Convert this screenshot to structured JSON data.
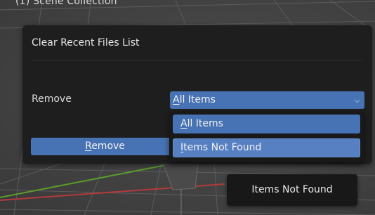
{
  "viewport": {
    "scene_collection_label": "(1) Scene Collection"
  },
  "dialog": {
    "title": "Clear Recent Files List",
    "remove_label": "Remove",
    "select_value": "All Items",
    "select_value_accel": "A",
    "select_value_rest": "ll Items",
    "remove_button_accel": "R",
    "remove_button_rest": "emove",
    "remove_button_label": "Remove"
  },
  "menu": {
    "options": [
      {
        "label": "All Items",
        "accel": "A",
        "rest": "ll Items",
        "state": "selected"
      },
      {
        "label": "Items Not Found",
        "accel": "I",
        "rest": "tems Not Found",
        "state": "hovered"
      }
    ]
  },
  "tooltip": {
    "text": "Items Not Found"
  },
  "colors": {
    "accent": "#4772b3",
    "hover": "#5680c2",
    "dialog_bg": "#1e1e1e",
    "grid_red": "#b33a3a",
    "grid_green": "#5a9e2c"
  },
  "icons": {
    "select_chevron": "chevron-down-icon"
  }
}
